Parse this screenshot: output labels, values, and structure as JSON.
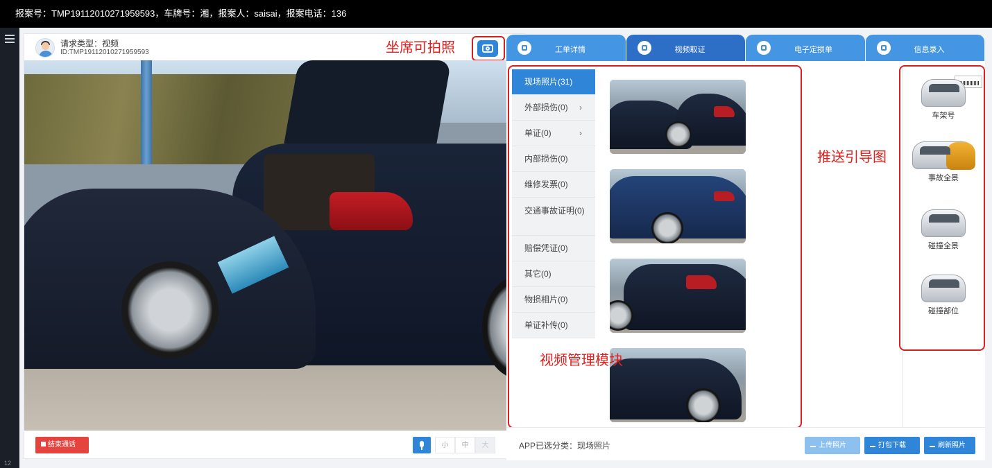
{
  "topbar": {
    "report_text": "报案号：TMP19112010271959593，车牌号：湘，报案人：saisai，报案电话：136"
  },
  "sidebar": {
    "page_number": "12"
  },
  "video": {
    "request_type": "请求类型：视频",
    "request_id": "ID:TMP19112010271959593",
    "annotation_camera": "坐席可拍照",
    "end_call_label": "结束通话",
    "sizes": [
      "小",
      "中",
      "大"
    ]
  },
  "tabs": [
    {
      "label": "工单详情",
      "icon": "info-icon"
    },
    {
      "label": "视频取证",
      "icon": "camera-icon"
    },
    {
      "label": "电子定损单",
      "icon": "car-icon"
    },
    {
      "label": "信息录入",
      "icon": "edit-icon"
    }
  ],
  "categories": [
    {
      "label": "现场照片(31)",
      "active": true
    },
    {
      "label": "外部损伤(0)",
      "arrow": "›"
    },
    {
      "label": "单证(0)",
      "arrow": "›"
    },
    {
      "label": "内部损伤(0)"
    },
    {
      "label": "维修发票(0)"
    },
    {
      "label": "交通事故证明(0)"
    },
    {
      "label": "赔偿凭证(0)"
    },
    {
      "label": "其它(0)"
    },
    {
      "label": "物损相片(0)"
    },
    {
      "label": "单证补传(0)"
    }
  ],
  "annotations": {
    "push_guide": "推送引导图",
    "video_module": "视频管理模块"
  },
  "guides": [
    {
      "label": "车架号"
    },
    {
      "label": "事故全景"
    },
    {
      "label": "碰撞全景"
    },
    {
      "label": "碰撞部位"
    }
  ],
  "footer": {
    "category_text": "APP已选分类：现场照片",
    "upload_label": "上传照片",
    "download_label": "打包下载",
    "refresh_label": "刷新照片"
  },
  "colors": {
    "accent": "#2f86d8",
    "annotation": "#e0201e",
    "end_call": "#e5443e"
  }
}
